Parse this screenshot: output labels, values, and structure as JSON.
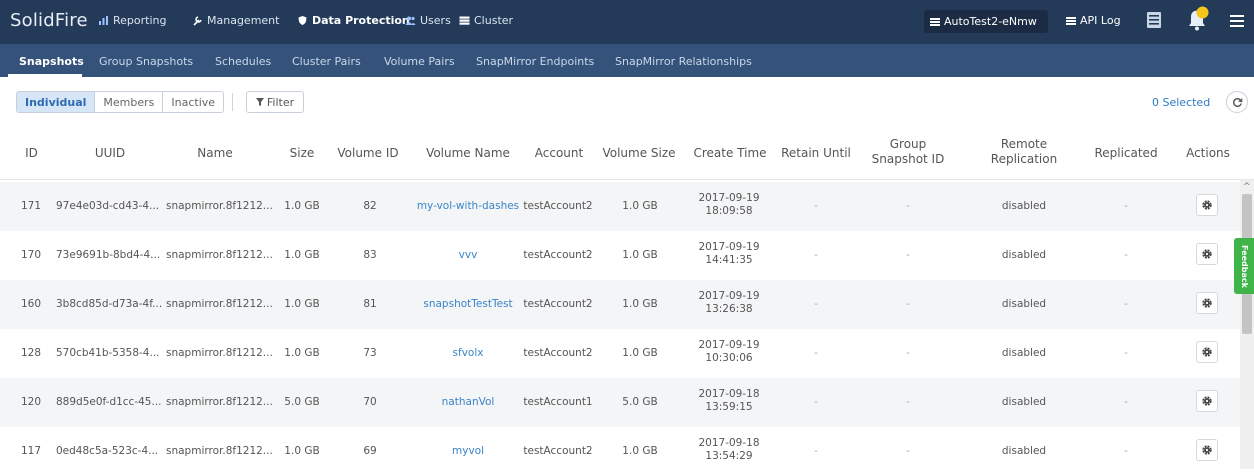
{
  "brand": "SolidFire",
  "topnav": [
    {
      "label": "Reporting",
      "icon": "chart-icon"
    },
    {
      "label": "Management",
      "icon": "wrench-icon"
    },
    {
      "label": "Data Protection",
      "icon": "shield-icon",
      "active": true
    },
    {
      "label": "Users",
      "icon": "users-icon"
    },
    {
      "label": "Cluster",
      "icon": "server-icon"
    }
  ],
  "account": "AutoTest2-eNmw",
  "api_log": "API Log",
  "subnav": [
    {
      "label": "Snapshots",
      "active": true
    },
    {
      "label": "Group Snapshots"
    },
    {
      "label": "Schedules"
    },
    {
      "label": "Cluster Pairs"
    },
    {
      "label": "Volume Pairs"
    },
    {
      "label": "SnapMirror Endpoints"
    },
    {
      "label": "SnapMirror Relationships"
    }
  ],
  "view_toggle": [
    "Individual",
    "Members",
    "Inactive"
  ],
  "filter_label": "Filter",
  "selected_label": "0 Selected",
  "columns": [
    "ID",
    "UUID",
    "Name",
    "Size",
    "Volume ID",
    "Volume Name",
    "Account",
    "Volume Size",
    "Create Time",
    "Retain Until",
    "Group Snapshot ID",
    "Remote Replication",
    "Replicated",
    "Actions"
  ],
  "rows": [
    {
      "id": "171",
      "uuid": "97e4e03d-cd43-4...",
      "name": "snapmirror.8f1212...",
      "size": "1.0 GB",
      "volume_id": "82",
      "volume_name": "my-vol-with-dashes",
      "account": "testAccount2",
      "volume_size": "1.0 GB",
      "create_date": "2017-09-19",
      "create_time": "18:09:58",
      "retain_until": "-",
      "group_snapshot_id": "-",
      "remote_replication": "disabled",
      "replicated": "-"
    },
    {
      "id": "170",
      "uuid": "73e9691b-8bd4-4...",
      "name": "snapmirror.8f1212...",
      "size": "1.0 GB",
      "volume_id": "83",
      "volume_name": "vvv",
      "account": "testAccount2",
      "volume_size": "1.0 GB",
      "create_date": "2017-09-19",
      "create_time": "14:41:35",
      "retain_until": "-",
      "group_snapshot_id": "-",
      "remote_replication": "disabled",
      "replicated": "-"
    },
    {
      "id": "160",
      "uuid": "3b8cd85d-d73a-4f...",
      "name": "snapmirror.8f1212...",
      "size": "1.0 GB",
      "volume_id": "81",
      "volume_name": "snapshotTestTest",
      "account": "testAccount2",
      "volume_size": "1.0 GB",
      "create_date": "2017-09-19",
      "create_time": "13:26:38",
      "retain_until": "-",
      "group_snapshot_id": "-",
      "remote_replication": "disabled",
      "replicated": "-"
    },
    {
      "id": "128",
      "uuid": "570cb41b-5358-4...",
      "name": "snapmirror.8f1212...",
      "size": "1.0 GB",
      "volume_id": "73",
      "volume_name": "sfvolx",
      "account": "testAccount2",
      "volume_size": "1.0 GB",
      "create_date": "2017-09-19",
      "create_time": "10:30:06",
      "retain_until": "-",
      "group_snapshot_id": "-",
      "remote_replication": "disabled",
      "replicated": "-"
    },
    {
      "id": "120",
      "uuid": "889d5e0f-d1cc-45...",
      "name": "snapmirror.8f1212...",
      "size": "5.0 GB",
      "volume_id": "70",
      "volume_name": "nathanVol",
      "account": "testAccount1",
      "volume_size": "5.0 GB",
      "create_date": "2017-09-18",
      "create_time": "13:59:15",
      "retain_until": "-",
      "group_snapshot_id": "-",
      "remote_replication": "disabled",
      "replicated": "-"
    },
    {
      "id": "117",
      "uuid": "0ed48c5a-523c-4...",
      "name": "snapmirror.8f1212...",
      "size": "1.0 GB",
      "volume_id": "69",
      "volume_name": "myvol",
      "account": "testAccount2",
      "volume_size": "1.0 GB",
      "create_date": "2017-09-18",
      "create_time": "13:54:29",
      "retain_until": "-",
      "group_snapshot_id": "-",
      "remote_replication": "disabled",
      "replicated": "-"
    }
  ],
  "feedback_label": "Feedback",
  "colors": {
    "topbar": "#243a59",
    "subbar": "#34527a",
    "link": "#3a84c8",
    "feedback": "#3fb549",
    "notification": "#f5c518"
  }
}
